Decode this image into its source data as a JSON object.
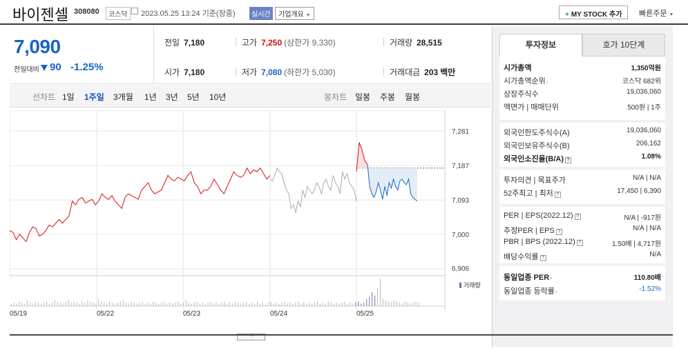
{
  "header": {
    "name": "바이젠셀",
    "code": "308080",
    "market": "코스닥",
    "date": "2023.05.25 13:24  기준(장중)",
    "realtime": "실시간",
    "corp_info": "기업개요",
    "mystock": "MY STOCK 추가",
    "quick_order": "빠른주문"
  },
  "price": {
    "current": "7,090",
    "change_label": "전일대비",
    "change": "90",
    "change_pct": "-1.25%",
    "direction": "down"
  },
  "stats": {
    "prev_label": "전일",
    "prev": "7,180",
    "high_label": "고가",
    "high": "7,250",
    "upper_limit": "(상한가 9,330)",
    "volume_label": "거래량",
    "volume": "28,515",
    "open_label": "시가",
    "open": "7,180",
    "low_label": "저가",
    "low": "7,080",
    "lower_limit": "(하한가 5,030)",
    "amount_label": "거래대금",
    "amount": "203",
    "amount_unit": "백만"
  },
  "tabs": {
    "line_chart": "선차트",
    "periods": [
      "1일",
      "1주일",
      "3개월",
      "1년",
      "3년",
      "5년",
      "10년"
    ],
    "selected": "1주일",
    "candle_chart": "봉차트",
    "candles": [
      "일봉",
      "주봉",
      "월봉"
    ]
  },
  "chart_data": {
    "type": "line",
    "yticks": [
      "7,281",
      "7,187",
      "7,093",
      "7,000",
      "6,906"
    ],
    "ylim": [
      6906,
      7281
    ],
    "reference_price": 7180,
    "xticks": [
      "05/19",
      "05/22",
      "05/23",
      "05/24",
      "05/25"
    ],
    "volume_legend": "거래량",
    "colors": {
      "up": "#d31010",
      "mid": "#aaaaaa",
      "down": "#1a63c4",
      "volume": "#7a6fb5"
    },
    "series": [
      {
        "segment": "05/19-05/23",
        "color": "up",
        "values": [
          7010,
          7005,
          6985,
          7000,
          6990,
          6980,
          7005,
          7020,
          7015,
          6995,
          7000,
          7010,
          7025,
          7020,
          7030,
          7040,
          7030,
          7040,
          7050,
          7090,
          7080,
          7095,
          7100,
          7085,
          7090,
          7095,
          7080,
          7090,
          7110,
          7100,
          7095,
          7105,
          7090,
          7080,
          7070,
          7100,
          7110,
          7105,
          7100,
          7095,
          7120,
          7130,
          7140,
          7120,
          7110,
          7115,
          7120,
          7140,
          7160,
          7150,
          7145,
          7155,
          7150,
          7145,
          7160,
          7170,
          7140,
          7130,
          7110,
          7120,
          7120,
          7130,
          7150,
          7135,
          7120,
          7110,
          7130,
          7150,
          7170,
          7160,
          7155,
          7160,
          7180,
          7165,
          7175,
          7170,
          7180,
          7165,
          7150,
          7160
        ]
      },
      {
        "segment": "05/24",
        "color": "mid",
        "values": [
          7150,
          7145,
          7160,
          7180,
          7170,
          7165,
          7140,
          7120,
          7110,
          7070,
          7080,
          7060,
          7090,
          7075,
          7120,
          7100,
          7130,
          7120,
          7110,
          7120,
          7140,
          7130,
          7110,
          7140,
          7150,
          7130,
          7120,
          7160,
          7140,
          7130,
          7110,
          7170,
          7150,
          7165,
          7140,
          7130,
          7120,
          7090
        ]
      },
      {
        "segment": "05/25 open",
        "color": "up",
        "values": [
          7170,
          7250,
          7230,
          7200,
          7190
        ]
      },
      {
        "segment": "05/25",
        "color": "down",
        "values": [
          7190,
          7130,
          7110,
          7100,
          7115,
          7140,
          7120,
          7095,
          7130,
          7105,
          7140,
          7125,
          7150,
          7130,
          7120,
          7145,
          7150,
          7140,
          7135,
          7150,
          7110,
          7100,
          7095,
          7090
        ]
      }
    ],
    "volume": [
      2,
      3,
      2,
      4,
      3,
      2,
      5,
      3,
      2,
      4,
      3,
      2,
      3,
      4,
      2,
      3,
      5,
      4,
      3,
      2,
      4,
      6,
      3,
      4,
      3,
      2,
      4,
      3,
      5,
      4,
      3,
      2,
      6,
      4,
      3,
      2,
      4,
      3,
      2,
      3,
      4,
      5,
      3,
      2,
      4,
      3,
      2,
      3,
      4,
      2,
      3,
      2,
      4,
      3,
      2,
      3,
      4,
      2,
      3,
      2,
      3,
      4,
      2,
      3,
      5,
      3,
      2,
      3,
      4,
      2,
      3,
      2,
      3,
      4,
      2,
      3,
      2,
      3,
      4,
      2,
      3,
      2,
      4,
      3,
      2,
      3,
      4,
      2,
      3,
      2,
      4,
      2,
      3,
      2,
      3,
      4,
      2,
      3,
      2,
      3,
      4,
      2,
      3,
      2,
      3,
      4,
      2,
      3,
      2,
      3,
      2,
      3,
      4,
      2,
      3,
      2,
      4,
      3,
      2,
      3,
      2,
      3,
      4,
      2,
      3,
      2,
      3,
      4,
      2,
      3,
      6,
      8,
      12,
      9,
      16,
      24,
      6,
      5,
      4,
      3,
      5,
      4,
      3,
      2,
      4,
      3,
      2,
      3,
      4,
      3
    ]
  },
  "right": {
    "tab_invest": "투자정보",
    "tab_hoga": "호가 10단계",
    "block1": [
      {
        "k": "시가총액",
        "v": "1,350억원",
        "bold": true
      },
      {
        "k": "시가총액순위",
        "v": "코스닥 682위",
        "arrow": true
      },
      {
        "k": "상장주식수",
        "v": "19,036,060"
      },
      {
        "k": "액면가 | 매매단위",
        "v": "500원  |  1주"
      }
    ],
    "block2": [
      {
        "k": "외국인한도주식수(A)",
        "v": "19,036,060"
      },
      {
        "k": "외국인보유주식수(B)",
        "v": "206,162"
      },
      {
        "k": "외국인소진율(B/A)",
        "v": "1.08%",
        "bold": true,
        "q": true
      }
    ],
    "block3": [
      {
        "k": "투자의견 | 목표주가",
        "v": "N/A  |  N/A"
      },
      {
        "k": "52주최고 | 최저",
        "v": "17,450  |  6,390",
        "q": true
      }
    ],
    "block4": [
      {
        "k": "PER | EPS(2022.12)",
        "v": "N/A  |  -917원",
        "q": true
      },
      {
        "k": "추정PER | EPS",
        "v": "N/A  |  N/A",
        "q": true
      },
      {
        "k": "PBR | BPS (2022.12)",
        "v": "1.50배  |  4,717원",
        "q": true
      },
      {
        "k": "배당수익률",
        "v": "N/A",
        "q": true
      }
    ],
    "block5": [
      {
        "k": "동일업종 PER",
        "v": "110.80배",
        "bold": true,
        "arrow": true
      },
      {
        "k": "동일업종 등락률",
        "v": "-1.52%",
        "neg": true,
        "arrow": true
      }
    ]
  }
}
